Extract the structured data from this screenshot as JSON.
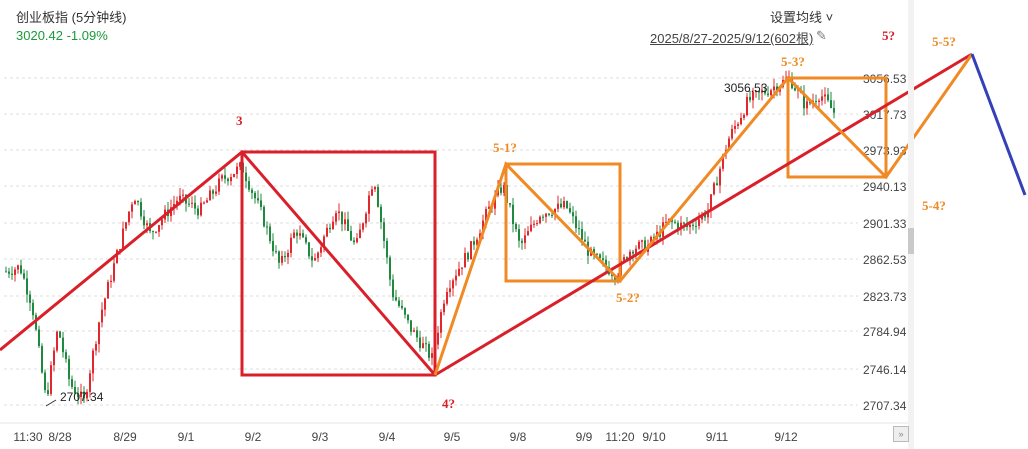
{
  "header": {
    "title": "创业板指 (5分钟线)",
    "quote": "3020.42  -1.09%",
    "ma_button": "设置均线 ˅",
    "range": "2025/8/27-2025/9/12(602根)",
    "pin_icon": "pin-icon"
  },
  "colors": {
    "up": "#e0282e",
    "down": "#1f8a3f",
    "red_line": "#d9202a",
    "orange_line": "#f08a24",
    "blue_line": "#3340b8",
    "red_label": "#d9202a",
    "orange_label": "#f08a24"
  },
  "chart_data": {
    "type": "candlestick",
    "y_ticks": [
      "3056.53",
      "3017.73",
      "2973.93",
      "2940.13",
      "2901.33",
      "2862.53",
      "2823.73",
      "2784.94",
      "2746.14",
      "2707.34"
    ],
    "x_ticks": [
      "11:30",
      "8/28",
      "8/29",
      "9/1",
      "9/2",
      "9/3",
      "9/4",
      "9/5",
      "9/8",
      "9/9",
      "11:20",
      "9/10",
      "9/11",
      "9/12"
    ],
    "ylim": [
      2707.34,
      3056.53
    ],
    "marked_high": "3056.53",
    "marked_low": "2707.34",
    "wave_labels": [
      {
        "text": "3",
        "color": "red"
      },
      {
        "text": "4?",
        "color": "red"
      },
      {
        "text": "5?",
        "color": "red"
      },
      {
        "text": "5-1?",
        "color": "orange"
      },
      {
        "text": "5-2?",
        "color": "orange"
      },
      {
        "text": "5-3?",
        "color": "orange"
      },
      {
        "text": "5-4?",
        "color": "orange"
      },
      {
        "text": "5-5?",
        "color": "orange"
      }
    ]
  }
}
